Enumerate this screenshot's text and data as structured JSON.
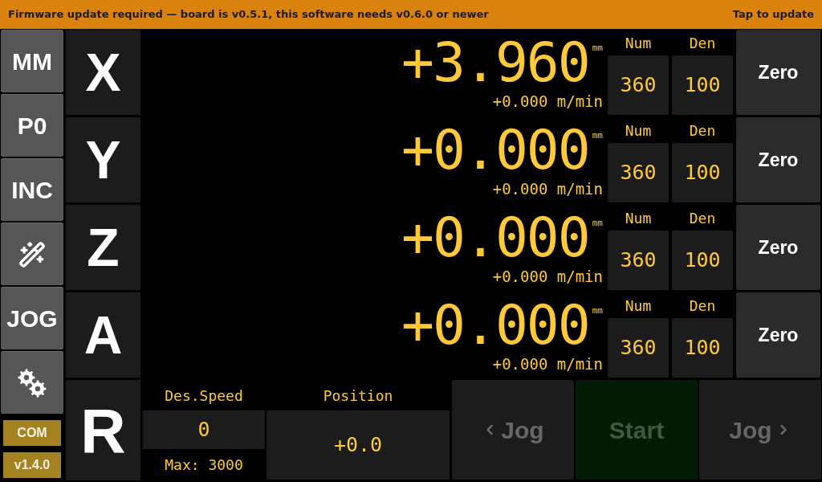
{
  "banner": {
    "message": "Firmware update required — board is v0.5.1, this software needs v0.6.0 or newer",
    "action": "Tap to update"
  },
  "sidebar": {
    "buttons": [
      {
        "kind": "text",
        "label": "MM"
      },
      {
        "kind": "text",
        "label": "P0"
      },
      {
        "kind": "text",
        "label": "INC"
      },
      {
        "kind": "wand"
      },
      {
        "kind": "text",
        "label": "JOG"
      },
      {
        "kind": "gears"
      }
    ],
    "badges": [
      "COM",
      "v1.4.0"
    ]
  },
  "axes": [
    {
      "name": "X",
      "position": "+3.960",
      "unit": "mm",
      "speed": "+0.000 m/min",
      "num_label": "Num",
      "num": "360",
      "den_label": "Den",
      "den": "100",
      "zero": "Zero"
    },
    {
      "name": "Y",
      "position": "+0.000",
      "unit": "mm",
      "speed": "+0.000 m/min",
      "num_label": "Num",
      "num": "360",
      "den_label": "Den",
      "den": "100",
      "zero": "Zero"
    },
    {
      "name": "Z",
      "position": "+0.000",
      "unit": "mm",
      "speed": "+0.000 m/min",
      "num_label": "Num",
      "num": "360",
      "den_label": "Den",
      "den": "100",
      "zero": "Zero"
    },
    {
      "name": "A",
      "position": "+0.000",
      "unit": "mm",
      "speed": "+0.000 m/min",
      "num_label": "Num",
      "num": "360",
      "den_label": "Den",
      "den": "100",
      "zero": "Zero"
    }
  ],
  "r_axis": {
    "name": "R",
    "speed_label": "Des.Speed",
    "speed": "0",
    "max": "Max: 3000",
    "position_label": "Position",
    "position": "+0.0",
    "buttons": [
      {
        "kind": "jog_left",
        "label": "Jog",
        "disabled": true
      },
      {
        "kind": "start",
        "label": "Start",
        "disabled": true
      },
      {
        "kind": "jog_right",
        "label": "Jog",
        "disabled": true
      }
    ]
  }
}
